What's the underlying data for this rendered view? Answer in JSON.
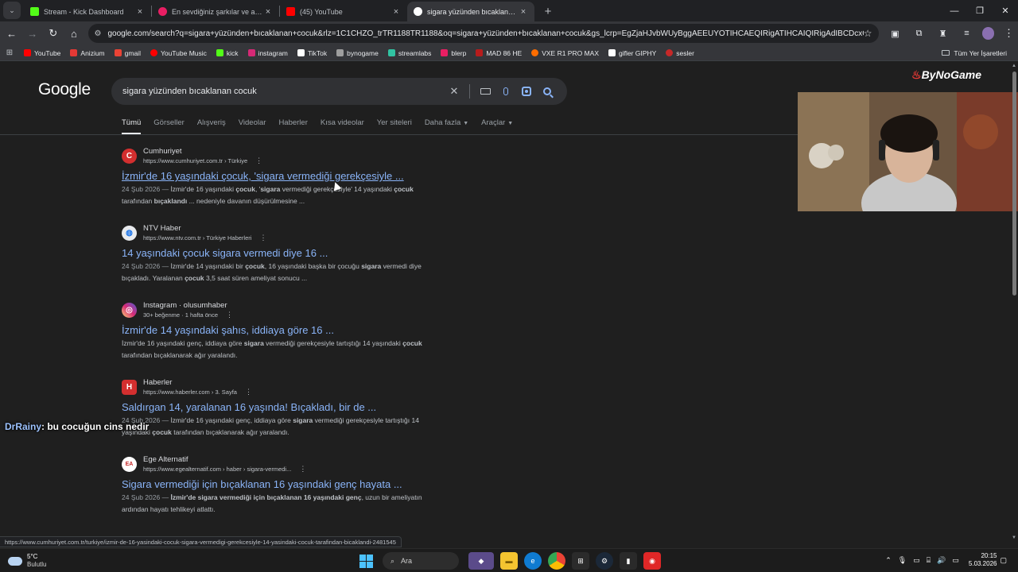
{
  "browser": {
    "tabs": [
      {
        "title": "Stream - Kick Dashboard",
        "color": "#53fc18",
        "active": false
      },
      {
        "title": "En sevdiğiniz şarkılar ve albümle",
        "color": "#e91e63",
        "active": false
      },
      {
        "title": "(45) YouTube",
        "color": "#ff0000",
        "active": false
      },
      {
        "title": "sigara yüzünden bıcaklanan cocuk",
        "color": "#4285f4",
        "active": true
      }
    ],
    "url": "google.com/search?q=sigara+yüzünden+bıcaklanan+cocuk&rlz=1C1CHZO_trTR1188TR1188&oq=sigara+yüzünden+bıcaklanan+cocuk&gs_lcrp=EgZjaHJvbWUyBggAEEUYOTIHCAEQIRigATIHCAIQIRigAdIBCDcxODNqMGo3qAIAs...",
    "bookmarks": [
      {
        "label": "YouTube",
        "color": "#ff0000"
      },
      {
        "label": "Anizium",
        "color": "#e53935"
      },
      {
        "label": "gmail",
        "color": "#ea4335"
      },
      {
        "label": "YouTube Music",
        "color": "#ff0000"
      },
      {
        "label": "kick",
        "color": "#53fc18"
      },
      {
        "label": "instagram",
        "color": "#d62976"
      },
      {
        "label": "TikTok",
        "color": "#ffffff"
      },
      {
        "label": "bynogame",
        "color": "#9e9e9e"
      },
      {
        "label": "streamlabs",
        "color": "#31c3a2"
      },
      {
        "label": "blerp",
        "color": "#e91e63"
      },
      {
        "label": "MAD 86 HE",
        "color": "#b71c1c"
      },
      {
        "label": "VXE R1 PRO MAX",
        "color": "#ff6d00"
      },
      {
        "label": "gifler GIPHY",
        "color": "#ffffff"
      },
      {
        "label": "sesler",
        "color": "#c62828"
      }
    ],
    "all_bookmarks": "Tüm Yer İşaretleri",
    "status_url": "https://www.cumhuriyet.com.tr/turkiye/izmir-de-16-yasindaki-cocuk-sigara-vermedigi-gerekcesiyle-14-yasindaki-cocuk-tarafindan-bicaklandi-2481545"
  },
  "google": {
    "logo": "Google",
    "query": "sigara yüzünden bıcaklanan cocuk",
    "filters": [
      "Tümü",
      "Görseller",
      "Alışveriş",
      "Videolar",
      "Haberler",
      "Kısa videolar",
      "Yer siteleri",
      "Daha fazla",
      "Araçlar"
    ],
    "results": [
      {
        "source": "Cumhuriyet",
        "url": "https://www.cumhuriyet.com.tr › Türkiye",
        "icon_letter": "C",
        "icon_color": "#d32f2f",
        "title": "İzmir'de 16 yaşındaki çocuk, 'sigara vermediği gerekçesiyle ...",
        "date": "24 Şub 2026 —",
        "snippet_1": " İzmir'de 16 yaşındaki ",
        "b1": "çocuk",
        "snippet_2": ", '",
        "b2": "sigara",
        "snippet_3": " vermediği gerekçesiyle' 14 yaşındaki ",
        "b3": "çocuk",
        "line2_1": "tarafından ",
        "line2_b": "bıçaklandı",
        "line2_2": " ... nedeniyle davanın düşürülmesine ..."
      },
      {
        "source": "NTV Haber",
        "url": "https://www.ntv.com.tr › Türkiye Haberleri",
        "icon_letter": "",
        "icon_color": "#e8eaed",
        "title": "14 yaşındaki çocuk sigara vermedi diye 16 ...",
        "date": "24 Şub 2026 —",
        "snippet_1": " İzmir'de 14 yaşındaki bir ",
        "b1": "çocuk",
        "snippet_2": ", 16 yaşındaki başka bir çocuğu ",
        "b2": "sigara",
        "snippet_3": " vermedi diye",
        "b3": "",
        "line2_1": "bıçakladı. Yaralanan ",
        "line2_b": "çocuk",
        "line2_2": " 3,5 saat süren ameliyat sonucu ..."
      },
      {
        "source": "Instagram · olusumhaber",
        "url": "30+ beğenme · 1 hafta önce",
        "icon_letter": "",
        "icon_color": "#d62976",
        "title": "İzmir'de 14 yaşındaki şahıs, iddiaya göre 16 ...",
        "date": "",
        "snippet_1": "İzmir'de 16 yaşındaki genç, iddiaya göre ",
        "b1": "sigara",
        "snippet_2": " vermediği gerekçesiyle tartıştığı 14 yaşındaki ",
        "b2": "çocuk",
        "snippet_3": "",
        "b3": "",
        "line2_1": "tarafından bıçaklanarak ağır yaralandı.",
        "line2_b": "",
        "line2_2": ""
      },
      {
        "source": "Haberler",
        "url": "https://www.haberler.com › 3. Sayfa",
        "icon_letter": "H",
        "icon_color": "#d32f2f",
        "title": "Saldırgan 14, yaralanan 16 yaşında! Bıçakladı, bir de ...",
        "date": "24 Şub 2026 —",
        "snippet_1": " İzmir'de 16 yaşındaki genç, iddiaya göre ",
        "b1": "sigara",
        "snippet_2": " vermediği gerekçesiyle tartıştığı 14",
        "b2": "",
        "snippet_3": "",
        "b3": "",
        "line2_1": "yaşındaki ",
        "line2_b": "çocuk",
        "line2_2": " tarafından bıçaklanarak ağır yaralandı."
      },
      {
        "source": "Ege Alternatif",
        "url": "https://www.egealternatif.com › haber › sigara-vermedi...",
        "icon_letter": "EA",
        "icon_color": "#ffffff",
        "title": "Sigara vermediği için bıçaklanan 16 yaşındaki genç hayata ...",
        "date": "24 Şub 2026 —",
        "snippet_1": " ",
        "b1": "İzmir'de sigara vermediği için bıçaklanan 16 yaşındaki genç",
        "snippet_2": ", uzun bir ameliyatın",
        "b2": "",
        "snippet_3": "",
        "b3": "",
        "line2_1": "ardından hayatı tehlikeyi atlattı.",
        "line2_b": "",
        "line2_2": ""
      }
    ]
  },
  "overlay": {
    "brand": "ByNoGame",
    "chat_user": "DrRainy",
    "chat_message": ": bu cocuğun cins nedir"
  },
  "taskbar": {
    "temp": "5°C",
    "weather": "Bulutlu",
    "search": "Ara",
    "time": "20:15",
    "date": "5.03.2026"
  }
}
